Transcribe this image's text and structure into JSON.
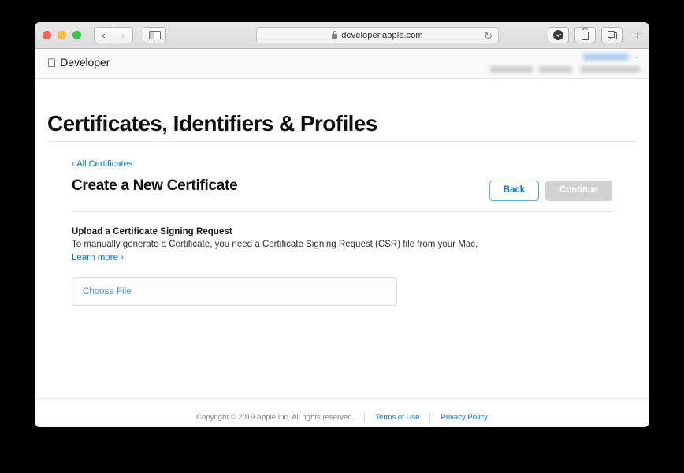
{
  "browser": {
    "traffic_lights": {
      "close_color": "#fc6058",
      "minimize_color": "#fdbc40",
      "zoom_color": "#34c749"
    },
    "nav": {
      "back_glyph": "‹",
      "forward_glyph": "›"
    },
    "address": {
      "url": "developer.apple.com",
      "secure": true,
      "reload_glyph": "↻"
    },
    "toolbar_right": {
      "new_tab_glyph": "+"
    }
  },
  "site": {
    "brand": {
      "logo_glyph": "",
      "name": "Developer"
    },
    "account": {
      "name_redacted": true,
      "team_redacted": true,
      "chevron_glyph": "⌄"
    },
    "page_title": "Certificates, Identifiers & Profiles"
  },
  "main": {
    "breadcrumb": "‹ All Certificates",
    "section_title": "Create a New Certificate",
    "buttons": {
      "back_label": "Back",
      "continue_label": "Continue",
      "continue_disabled": true
    },
    "upload": {
      "title": "Upload a Certificate Signing Request",
      "description": "To manually generate a Certificate, you need a Certificate Signing Request (CSR) file from your Mac.",
      "learn_more": "Learn more ›",
      "choose_file_label": "Choose File"
    }
  },
  "footer": {
    "copyright": "Copyright © 2019 Apple Inc. All rights reserved.",
    "terms_label": "Terms of Use",
    "privacy_label": "Privacy Policy"
  },
  "colors": {
    "link_blue": "#0070c9",
    "button_blue": "#1578d4",
    "disabled_gray": "#d2d2d2"
  }
}
